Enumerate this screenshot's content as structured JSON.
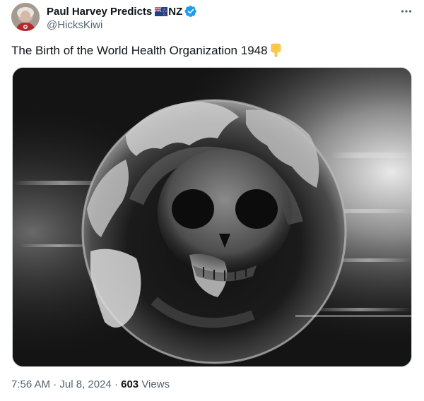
{
  "author": {
    "display_name": "Paul Harvey Predicts",
    "name_suffix": "NZ",
    "handle": "@HicksKiwi",
    "flag_icon": "new-zealand-flag-icon",
    "verified_icon": "verified-badge-icon",
    "verified_color": "#1d9bf0"
  },
  "tweet": {
    "text": "The Birth of the World Health Organization 1948",
    "emoji_icon": "backhand-index-pointing-down-emoji"
  },
  "media": {
    "icon": "skull-globe-image"
  },
  "meta": {
    "time": "7:56 AM",
    "separator1": " · ",
    "date": "Jul 8, 2024",
    "separator2": " · ",
    "views_count": "603",
    "views_label": " Views"
  },
  "colors": {
    "text_primary": "#0f1419",
    "text_secondary": "#536471",
    "border": "#cfd9de"
  }
}
